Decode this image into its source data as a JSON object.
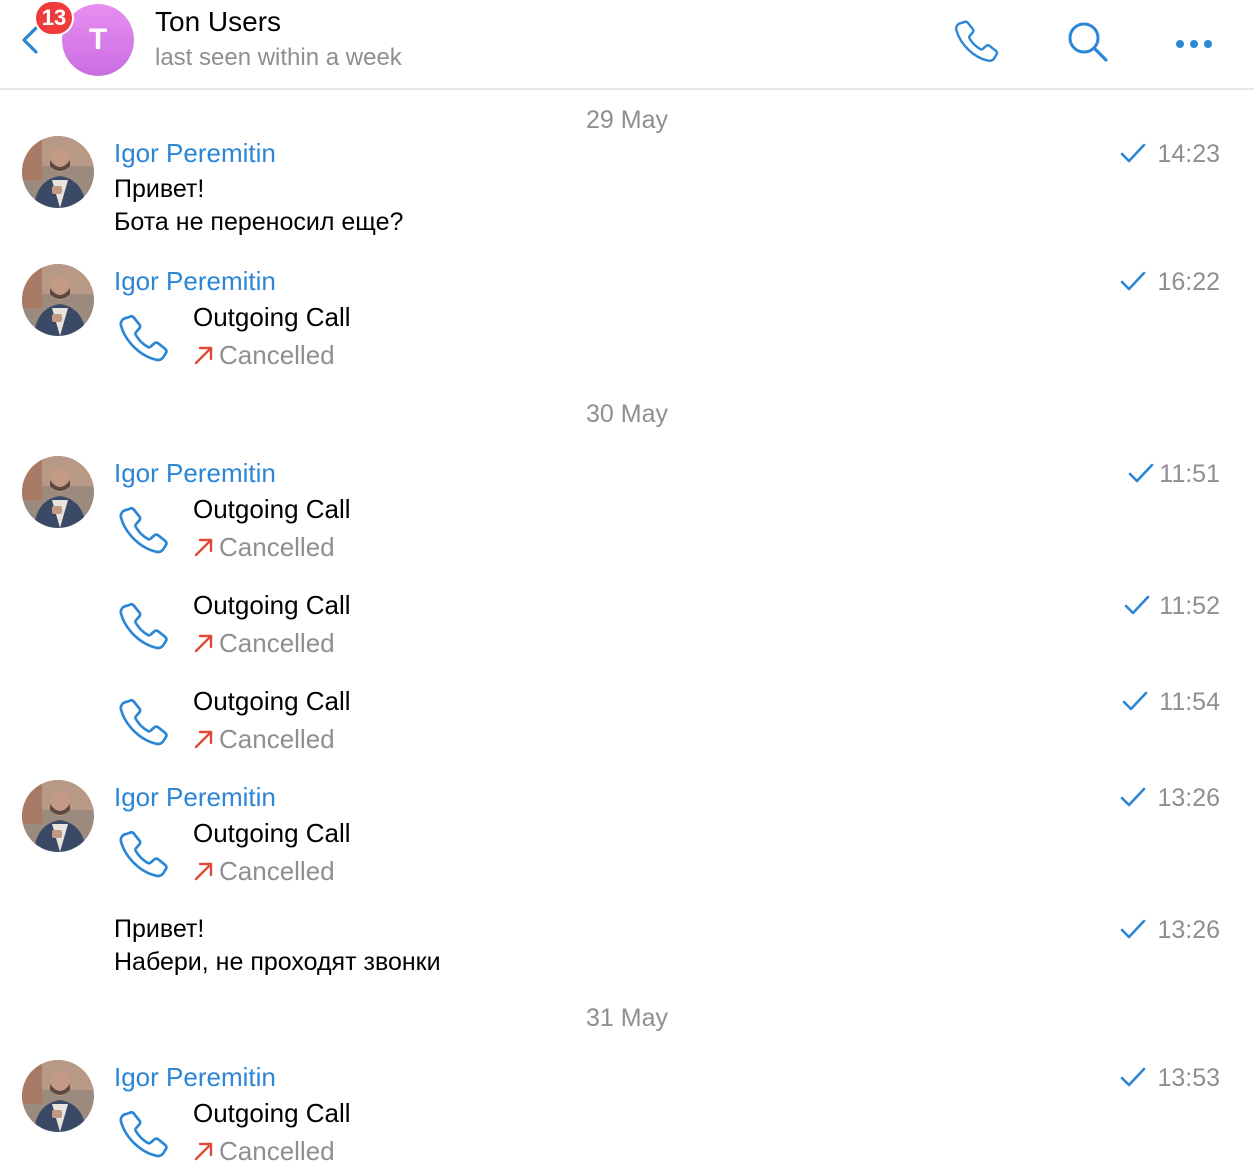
{
  "header": {
    "back_badge": "13",
    "avatar_letter": "T",
    "title": "Ton Users",
    "subtitle": "last seen within a week",
    "icons": [
      "back-chevron-icon",
      "phone-icon",
      "search-icon",
      "more-dots-icon"
    ]
  },
  "colors": {
    "accent": "#2b86d6",
    "badge": "#ef3b3b",
    "avatar_gradient": "#d87ee9",
    "muted": "#8e8e93",
    "missed_arrow": "#e04a3a"
  },
  "dates": [
    "29 May",
    "30 May",
    "31 May"
  ],
  "sender": "Igor Peremitin",
  "messages": [
    {
      "type": "text",
      "lines": [
        "Привет!",
        "Бота не переносил еще?"
      ],
      "time": "14:23"
    },
    {
      "type": "call",
      "title": "Outgoing Call",
      "status": "Cancelled",
      "time": "16:22"
    },
    {
      "type": "call",
      "title": "Outgoing Call",
      "status": "Cancelled",
      "time": "11:51"
    },
    {
      "type": "call",
      "title": "Outgoing Call",
      "status": "Cancelled",
      "time": "11:52"
    },
    {
      "type": "call",
      "title": "Outgoing Call",
      "status": "Cancelled",
      "time": "11:54"
    },
    {
      "type": "call",
      "title": "Outgoing Call",
      "status": "Cancelled",
      "time": "13:26"
    },
    {
      "type": "text",
      "lines": [
        "Привет!",
        "Набери, не проходят звонки"
      ],
      "time": "13:26"
    },
    {
      "type": "call",
      "title": "Outgoing Call",
      "status": "Cancelled",
      "time": "13:53"
    }
  ]
}
